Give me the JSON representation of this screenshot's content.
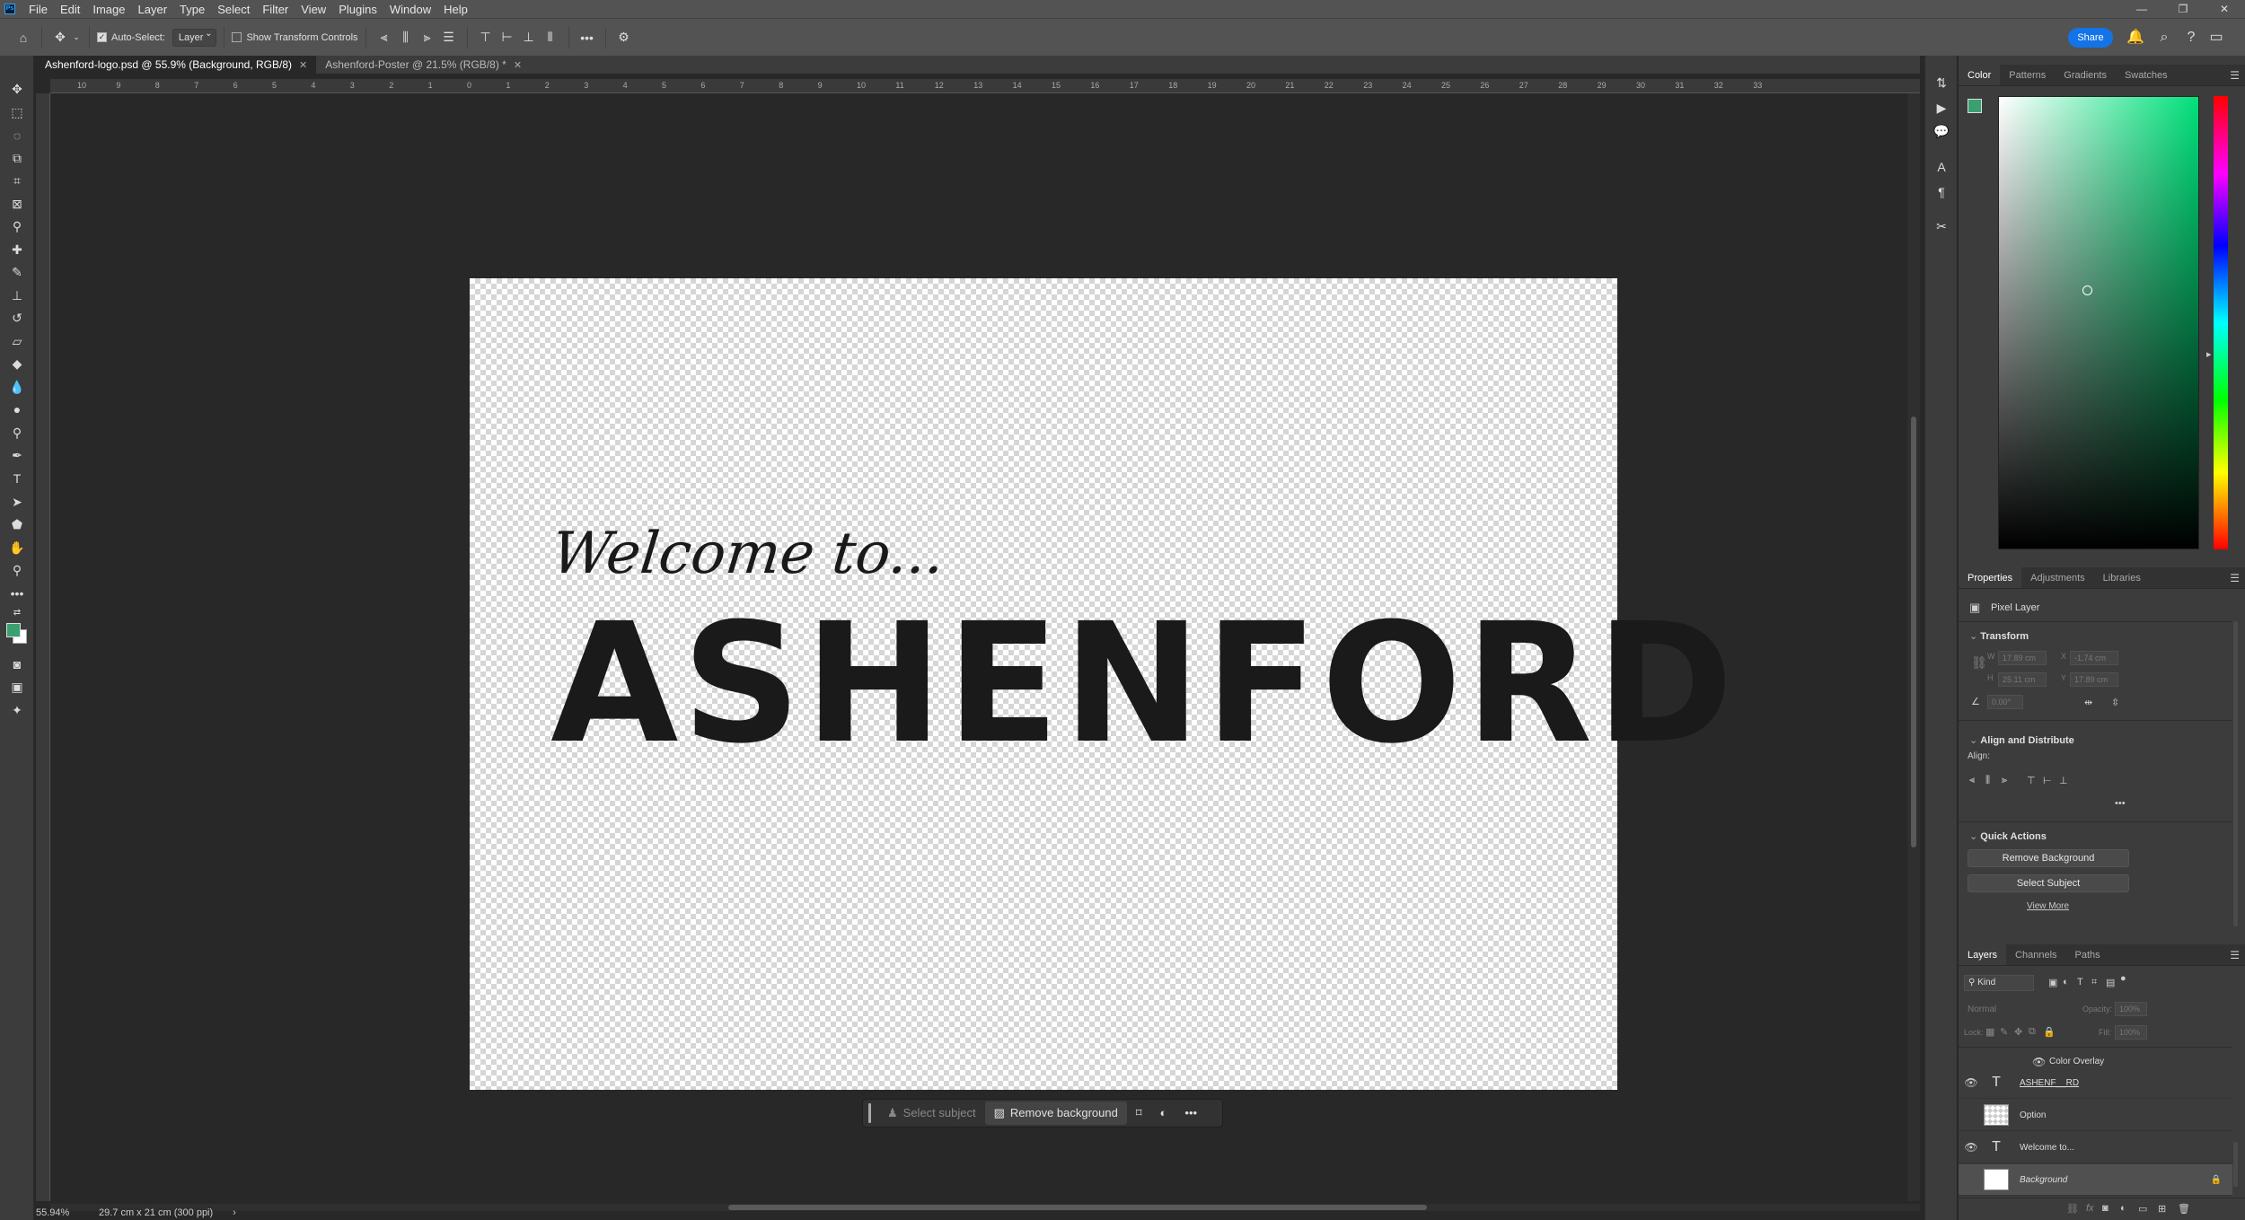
{
  "menu": {
    "logo": "Ps",
    "items": [
      "File",
      "Edit",
      "Image",
      "Layer",
      "Type",
      "Select",
      "Filter",
      "View",
      "Plugins",
      "Window",
      "Help"
    ],
    "window_controls": [
      "—",
      "❐",
      "✕"
    ]
  },
  "options_bar": {
    "auto_select_label": "Auto-Select:",
    "auto_select_target": "Layer",
    "show_transform_label": "Show Transform Controls",
    "share_label": "Share"
  },
  "tabs": [
    {
      "label": "Ashenford-logo.psd @ 55.9% (Background, RGB/8)",
      "active": true
    },
    {
      "label": "Ashenford-Poster @ 21.5% (RGB/8) *",
      "active": false
    }
  ],
  "ruler_top_labels": [
    "10",
    "9",
    "8",
    "7",
    "6",
    "5",
    "4",
    "3",
    "2",
    "1",
    "0",
    "1",
    "2",
    "3",
    "4",
    "5",
    "6",
    "7",
    "8",
    "9",
    "10",
    "11",
    "12",
    "13",
    "14",
    "15",
    "16",
    "17",
    "18",
    "19",
    "20",
    "21",
    "22",
    "23",
    "24",
    "25",
    "26",
    "27",
    "28",
    "29",
    "30",
    "31",
    "32",
    "33"
  ],
  "canvas": {
    "welcome_text": "Welcome to...",
    "brand_text": "ASHENFORD"
  },
  "task_bar": {
    "select_subject": "Select subject",
    "remove_background": "Remove background"
  },
  "status": {
    "zoom": "55.94%",
    "doc_size": "29.7 cm x 21 cm (300 ppi)"
  },
  "color_panel": {
    "tabs": [
      "Color",
      "Patterns",
      "Gradients",
      "Swatches"
    ],
    "foreground": "#3aa070",
    "background": "#ffffff"
  },
  "properties_panel": {
    "tabs": [
      "Properties",
      "Adjustments",
      "Libraries"
    ],
    "layer_type": "Pixel Layer",
    "transform_heading": "Transform",
    "fields": {
      "w": "W",
      "h": "H",
      "x": "X",
      "y": "Y",
      "w_val": "17.89 cm",
      "h_val": "25.11 cm",
      "x_val": "-1.74 cm",
      "y_val": "17.89 cm",
      "angle_val": "0.00°"
    },
    "align_heading": "Align and Distribute",
    "align_label": "Align:",
    "quick_actions_heading": "Quick Actions",
    "remove_bg_button": "Remove Background",
    "select_subject_button": "Select Subject",
    "view_more": "View More"
  },
  "layers_panel": {
    "tabs": [
      "Layers",
      "Channels",
      "Paths"
    ],
    "filter_kind": "Kind",
    "blend_mode": "Normal",
    "opacity_label": "Opacity:",
    "opacity_value": "100%",
    "lock_label": "Lock:",
    "fill_label": "Fill:",
    "fill_value": "100%",
    "effect_label": "Color Overlay",
    "layers": [
      {
        "name": "ASHENF__RD",
        "type": "text",
        "visible": true
      },
      {
        "name": "Option",
        "type": "pixel",
        "visible": false
      },
      {
        "name": "Welcome to...",
        "type": "text",
        "visible": true
      },
      {
        "name": "Background",
        "type": "background",
        "visible": false,
        "selected": true
      }
    ]
  }
}
